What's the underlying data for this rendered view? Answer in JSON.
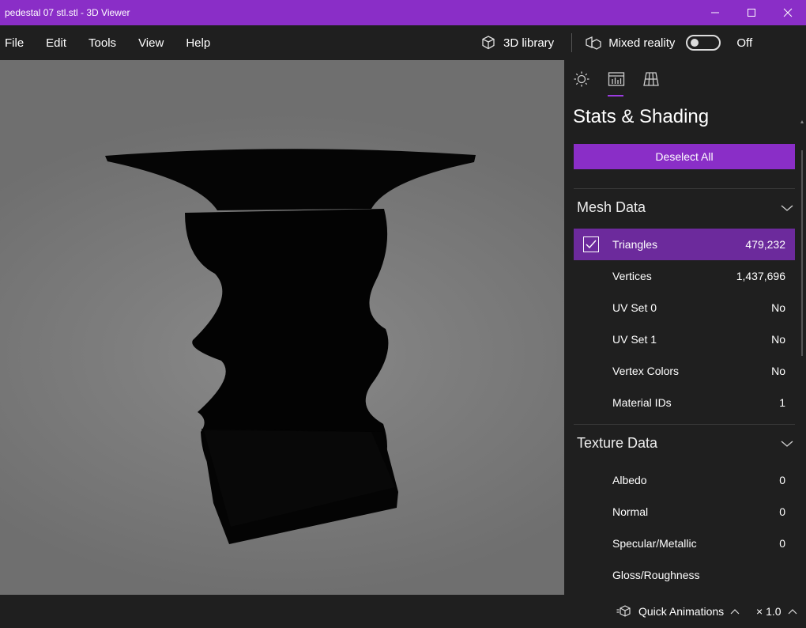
{
  "window": {
    "title": "pedestal 07 stl.stl - 3D Viewer",
    "accent": "#8a2ec7"
  },
  "menu": {
    "items": [
      "File",
      "Edit",
      "Tools",
      "View",
      "Help"
    ],
    "library_label": "3D library",
    "mixed_reality_label": "Mixed reality",
    "mixed_reality_state": "Off"
  },
  "panel": {
    "tabs": [
      "sun-icon",
      "stats-icon",
      "grid-icon"
    ],
    "active_tab": 1,
    "title": "Stats & Shading",
    "deselect_label": "Deselect All",
    "mesh_section": "Mesh Data",
    "mesh_rows": [
      {
        "label": "Triangles",
        "value": "479,232",
        "selected": true
      },
      {
        "label": "Vertices",
        "value": "1,437,696"
      },
      {
        "label": "UV Set 0",
        "value": "No"
      },
      {
        "label": "UV Set 1",
        "value": "No"
      },
      {
        "label": "Vertex Colors",
        "value": "No"
      },
      {
        "label": "Material IDs",
        "value": "1"
      }
    ],
    "texture_section": "Texture Data",
    "texture_rows": [
      {
        "label": "Albedo",
        "value": "0"
      },
      {
        "label": "Normal",
        "value": "0"
      },
      {
        "label": "Specular/Metallic",
        "value": "0"
      },
      {
        "label": "Gloss/Roughness",
        "value": ""
      }
    ]
  },
  "bottom": {
    "animations_label": "Quick Animations",
    "speed_label": "× 1.0"
  }
}
